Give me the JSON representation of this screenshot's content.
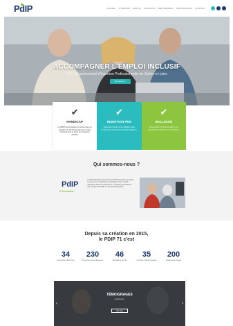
{
  "brand": {
    "logo": "PdIP",
    "accent": "#8cc63f",
    "teal": "#2bbcc0",
    "navy": "#1f3b6e"
  },
  "nav": {
    "items": [
      "Accueil",
      "À propos",
      "Emploi",
      "Handicap",
      "Partenaires",
      "Témoignages",
      "Contact"
    ],
    "social": [
      {
        "icon": "facebook-icon",
        "color": "#2bbcc0"
      },
      {
        "icon": "linkedin-icon",
        "color": "#1f3b6e"
      },
      {
        "icon": "youtube-icon",
        "color": "#1f3b6e"
      }
    ]
  },
  "hero": {
    "title": "ACCOMPAGNER L'EMPLOI INCLUSIF",
    "subtitle": "Pôle Départemental d'Insertion Professionnelle de Saône-et-Loire",
    "button": "En savoir +"
  },
  "cards": [
    {
      "icon": "check-icon",
      "title": "HANDICAP",
      "desc": "Le PDIP accompagne les personnes en situation de handicap dans leur projet professionnel et dans leur insertion durable."
    },
    {
      "icon": "check-icon",
      "title": "INSERTION PRO",
      "desc": "Favoriser l'accès et le maintien dans l'emploi des personnes les plus éloignées."
    },
    {
      "icon": "check-icon",
      "title": "INCLUSION",
      "desc": "Nos actions s'inscrivent dans une démarche d'inclusion sur le territoire."
    }
  ],
  "who": {
    "title": "Qui sommes-nous ?",
    "logo": "PdIP",
    "logo_sub": "Présentation",
    "text": "Le Pôle Départemental d'Insertion Professionnelle de Saône-et-Loire est un dispositif de coordination créé en 2015 regroupant plusieurs partenaires. Les fiches présentations des membres du PDIP 71 sont téléchargeables."
  },
  "since": {
    "line1": "Depuis sa création en 2015,",
    "line2": "le PDIP 71 c'est"
  },
  "stats": [
    {
      "value": "34",
      "label": "Structures adhérentes"
    },
    {
      "value": "230",
      "label": "Personnes accompagnées"
    },
    {
      "value": "46",
      "label": "Signataires de l'Ec"
    },
    {
      "value": "35",
      "label": "Contrats d'apprentissage"
    },
    {
      "value": "200",
      "label": "Sessions de stages"
    }
  ],
  "testimonials": {
    "title": "TÉMOIGNAGES",
    "subtitle": "Employeurs",
    "button": "Voir plus",
    "prev": "‹",
    "next": "›"
  }
}
